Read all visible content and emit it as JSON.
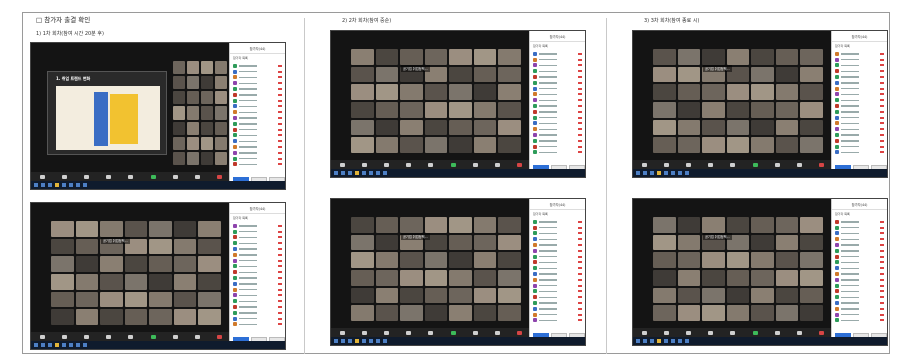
{
  "document": {
    "title": "□ 참가자 출결 확인",
    "sections": [
      {
        "caption": "1) 1차 회차(참여 시간 20분 후)"
      },
      {
        "caption": "2) 2차 회차(참여 중순)"
      },
      {
        "caption": "3) 3차 회차(참여 종료 시)"
      }
    ]
  },
  "screens": {
    "panel_title": "참가자(44)",
    "panel_subtitle": "참가자 목록",
    "slide_title": "1. 취업 트렌드 변화",
    "speaker_label": "공기업 취업정책...",
    "buttons": [
      "초대",
      "모두 음소거",
      "..."
    ]
  },
  "colors": {
    "accent": "#2d6fd6",
    "unmute_green": "#3dbb5a",
    "leave_red": "#d64545",
    "slide_yellow": "#f2c230"
  }
}
